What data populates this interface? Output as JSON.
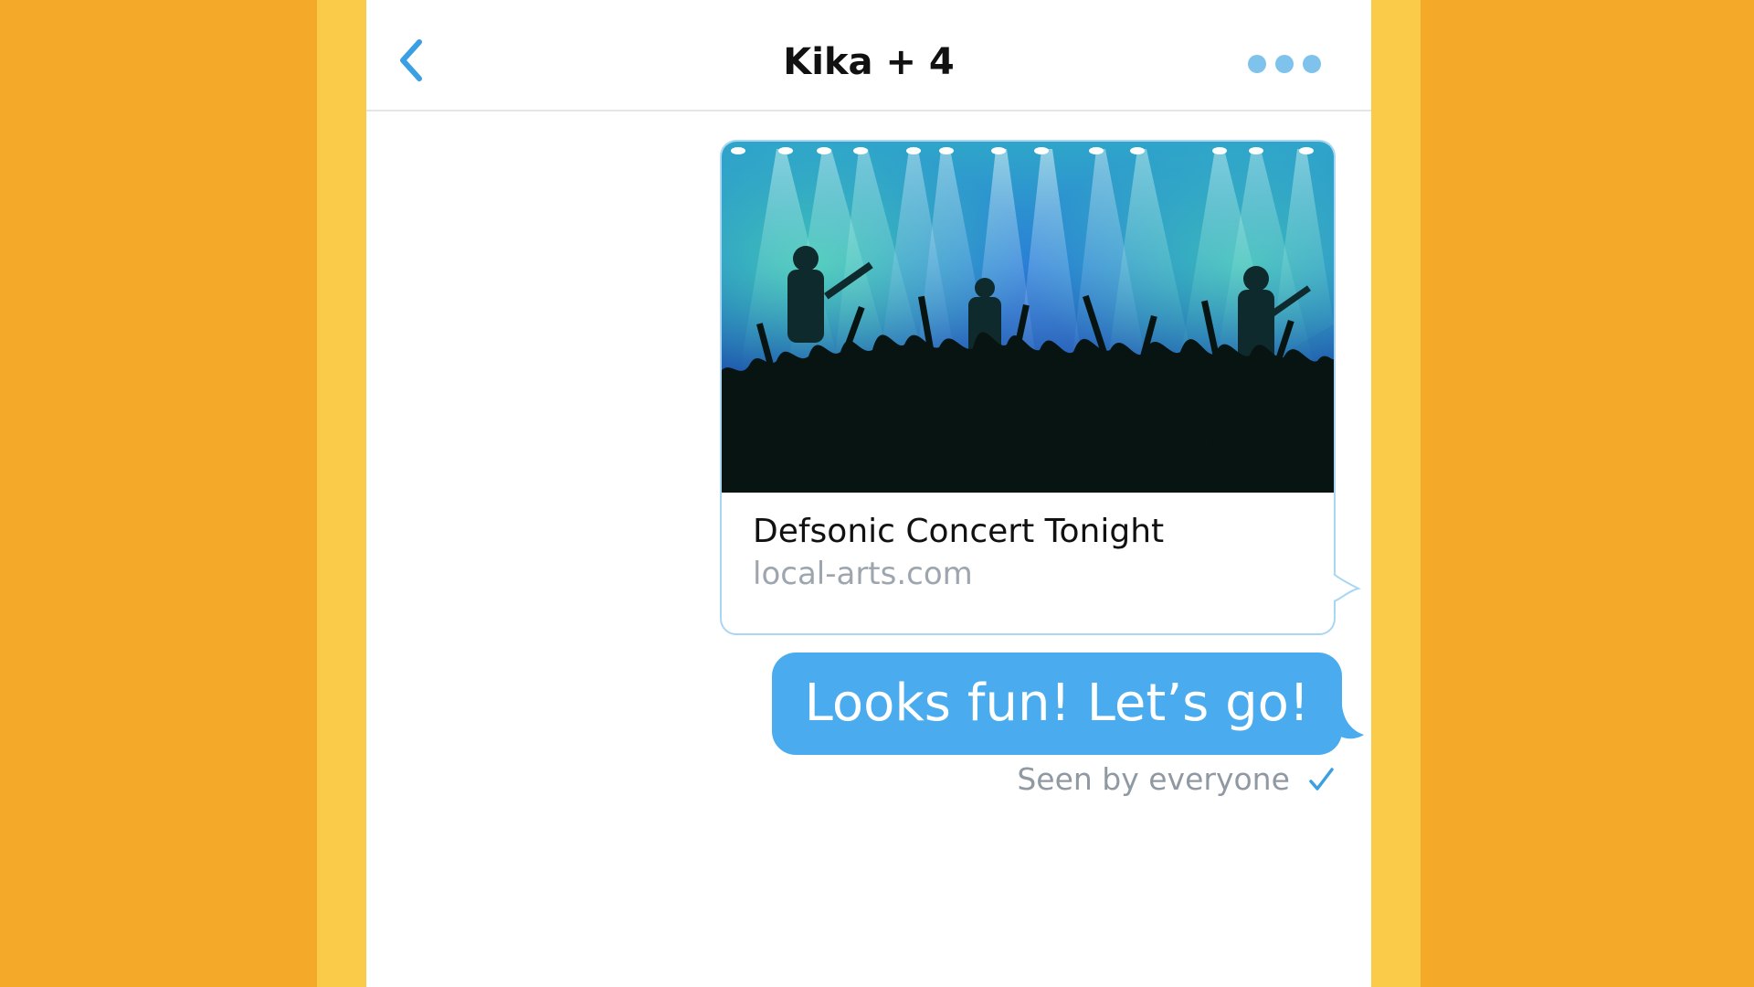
{
  "header": {
    "title": "Kika + 4",
    "back_icon": "chevron-left-icon",
    "more_icon": "more-dots-icon"
  },
  "link_card": {
    "image_description_icon": "concert-photo",
    "title": "Defsonic Concert Tonight",
    "url": "local-arts.com"
  },
  "message": {
    "text": "Looks fun! Let’s go!",
    "status": "Seen by everyone",
    "status_icon": "checkmark-icon"
  },
  "colors": {
    "accent": "#4AACEE",
    "background_outer": "#F5A928",
    "background_band": "#F9CB48",
    "dots": "#7FC3EC"
  }
}
